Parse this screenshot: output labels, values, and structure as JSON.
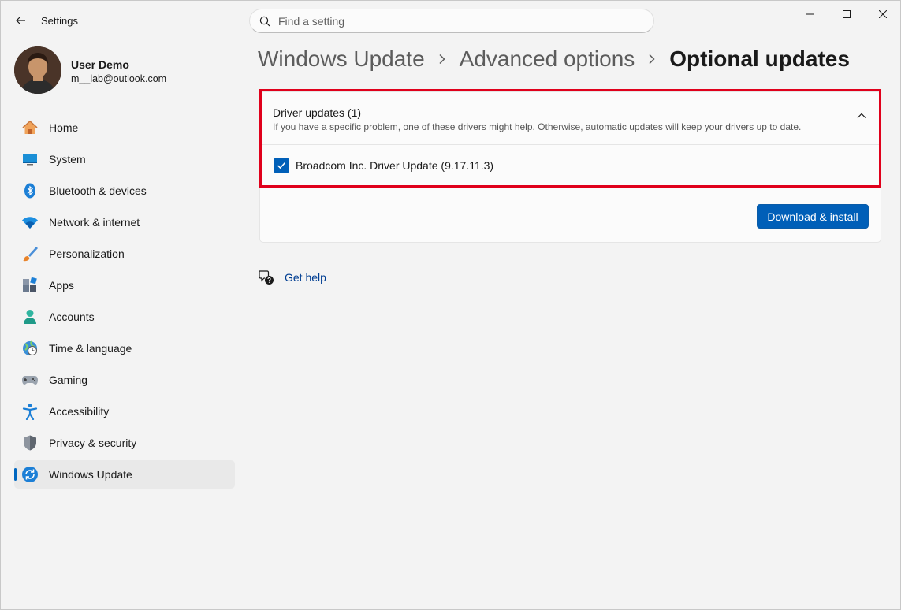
{
  "app": {
    "title": "Settings"
  },
  "search": {
    "placeholder": "Find a setting"
  },
  "user": {
    "name": "User Demo",
    "email": "m__lab@outlook.com"
  },
  "sidebar": {
    "items": [
      {
        "label": "Home",
        "icon": "home-icon"
      },
      {
        "label": "System",
        "icon": "system-icon"
      },
      {
        "label": "Bluetooth & devices",
        "icon": "bluetooth-icon"
      },
      {
        "label": "Network & internet",
        "icon": "wifi-icon"
      },
      {
        "label": "Personalization",
        "icon": "brush-icon"
      },
      {
        "label": "Apps",
        "icon": "apps-icon"
      },
      {
        "label": "Accounts",
        "icon": "accounts-icon"
      },
      {
        "label": "Time & language",
        "icon": "time-language-icon"
      },
      {
        "label": "Gaming",
        "icon": "gamepad-icon"
      },
      {
        "label": "Accessibility",
        "icon": "accessibility-icon"
      },
      {
        "label": "Privacy & security",
        "icon": "shield-icon"
      },
      {
        "label": "Windows Update",
        "icon": "windows-update-icon",
        "active": true
      }
    ]
  },
  "breadcrumb": {
    "level1": "Windows Update",
    "level2": "Advanced options",
    "current": "Optional updates"
  },
  "driver_updates": {
    "title": "Driver updates (1)",
    "description": "If you have a specific problem, one of these drivers might help. Otherwise, automatic updates will keep your drivers up to date.",
    "items": [
      {
        "label": "Broadcom Inc. Driver Update (9.17.11.3)",
        "checked": true
      }
    ]
  },
  "actions": {
    "download_install": "Download & install"
  },
  "help": {
    "label": "Get help"
  },
  "colors": {
    "accent": "#005fb8",
    "highlight": "#e0001b"
  }
}
